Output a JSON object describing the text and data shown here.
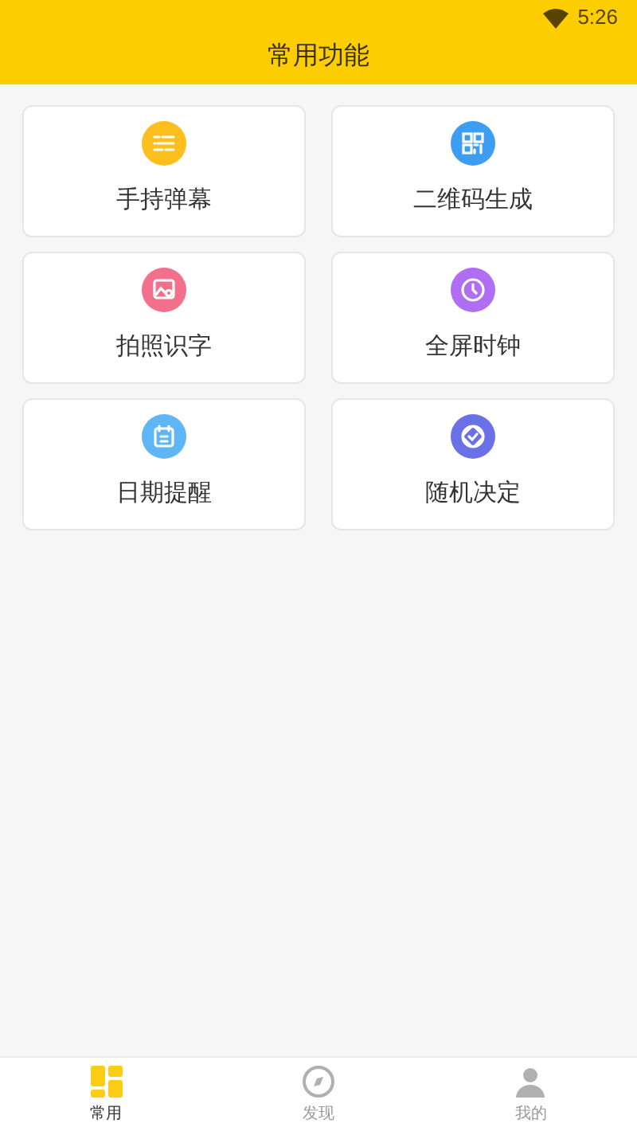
{
  "status_bar": {
    "time": "5:26"
  },
  "header": {
    "title": "常用功能"
  },
  "features": [
    {
      "label": "手持弹幕",
      "kind": "lines",
      "color": "#fcbf1e"
    },
    {
      "label": "二维码生成",
      "kind": "qr",
      "color": "#3d9df2"
    },
    {
      "label": "拍照识字",
      "kind": "photo",
      "color": "#f2708c"
    },
    {
      "label": "全屏时钟",
      "kind": "clock",
      "color": "#b06ef2"
    },
    {
      "label": "日期提醒",
      "kind": "calendar",
      "color": "#5fb6f7"
    },
    {
      "label": "随机决定",
      "kind": "badge",
      "color": "#6a70e6"
    }
  ],
  "nav": [
    {
      "label": "常用",
      "kind": "grid",
      "selected": true
    },
    {
      "label": "发现",
      "kind": "compass",
      "selected": false
    },
    {
      "label": "我的",
      "kind": "person",
      "selected": false
    }
  ]
}
